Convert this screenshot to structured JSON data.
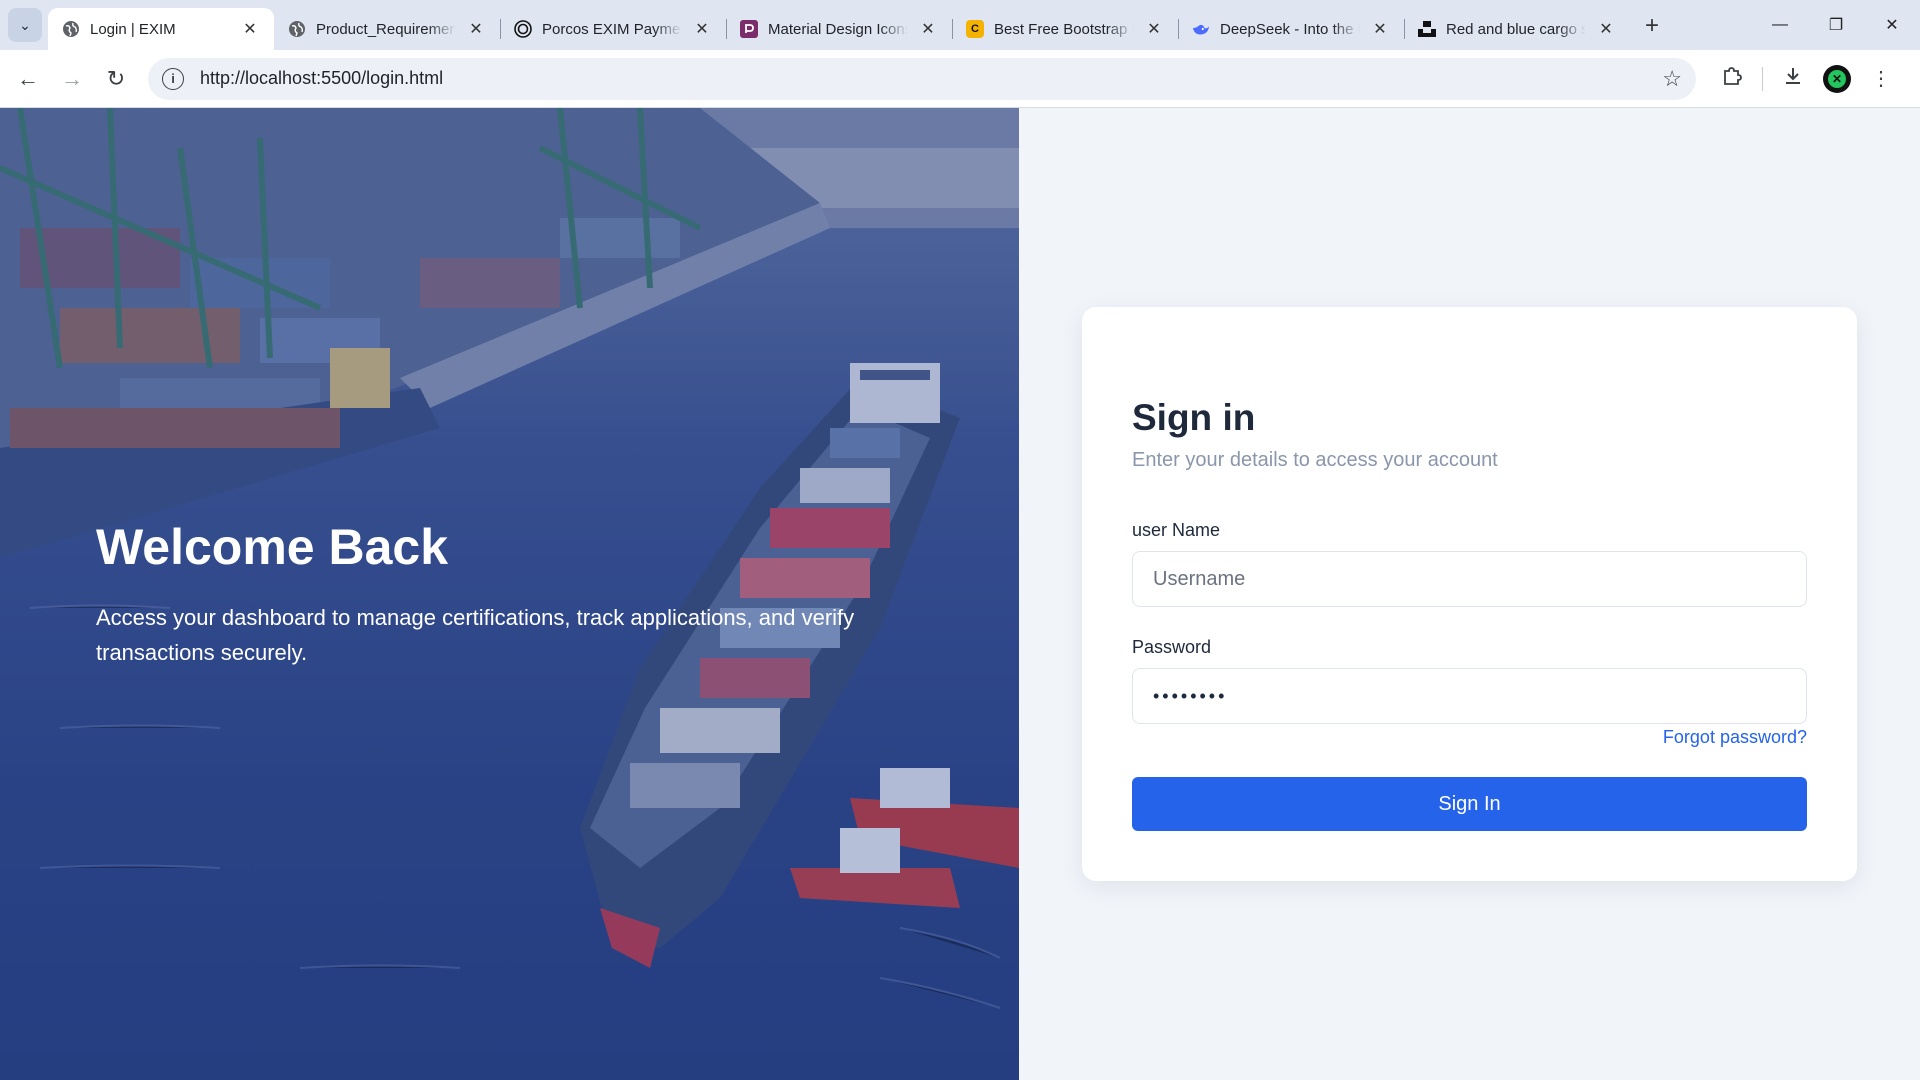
{
  "browser": {
    "tabs": [
      {
        "title": "Login | EXIM",
        "active": true,
        "favicon": "globe-icon",
        "favicon_color": "#5f6368"
      },
      {
        "title": "Product_Requirements",
        "active": false,
        "favicon": "globe-icon",
        "favicon_color": "#5f6368"
      },
      {
        "title": "Porcos EXIM Payments",
        "active": false,
        "favicon": "openai-icon",
        "favicon_color": "#111111"
      },
      {
        "title": "Material Design Icons",
        "active": false,
        "favicon": "pictogrammers-icon",
        "favicon_color": "#7b2d6b"
      },
      {
        "title": "Best Free Bootstrap Icons",
        "active": false,
        "favicon": "c-icon",
        "favicon_color": "#f5b301"
      },
      {
        "title": "DeepSeek - Into the Unknown",
        "active": false,
        "favicon": "deepseek-icon",
        "favicon_color": "#4d6bfe"
      },
      {
        "title": "Red and blue cargo ship",
        "active": false,
        "favicon": "unsplash-icon",
        "favicon_color": "#111111"
      }
    ],
    "url": "http://localhost:5500/login.html"
  },
  "hero": {
    "title": "Welcome Back",
    "description": "Access your dashboard to manage certifications, track applications, and verify transactions securely."
  },
  "login": {
    "title": "Sign in",
    "subtitle": "Enter your details to access your account",
    "username_label": "user Name",
    "username_placeholder": "Username",
    "username_value": "",
    "password_label": "Password",
    "password_value": "password",
    "forgot_label": "Forgot password?",
    "submit_label": "Sign In"
  },
  "colors": {
    "primary": "#2563eb",
    "page_bg": "#f1f4f9",
    "heading": "#1e293b",
    "muted": "#8a96ab"
  }
}
